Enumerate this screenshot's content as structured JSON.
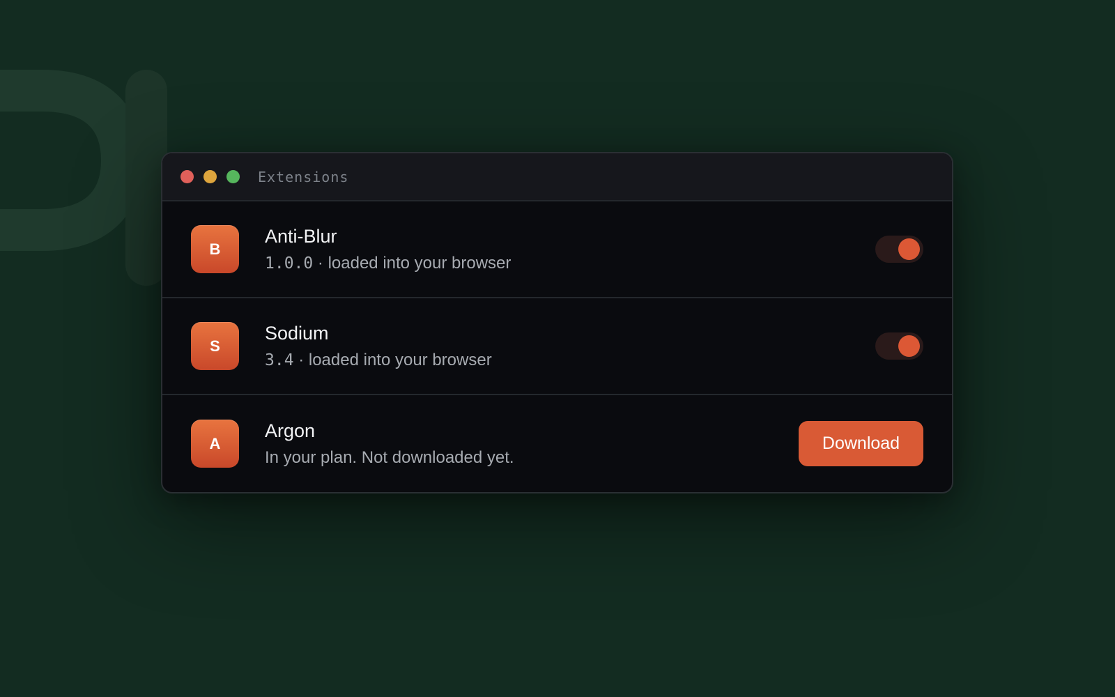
{
  "window": {
    "title": "Extensions"
  },
  "extensions": [
    {
      "icon_letter": "B",
      "name": "Anti-Blur",
      "version": "1.0.0",
      "status": " · loaded into your browser",
      "enabled": true
    },
    {
      "icon_letter": "S",
      "name": "Sodium",
      "version": "3.4",
      "status": " · loaded into your browser",
      "enabled": true
    },
    {
      "icon_letter": "A",
      "name": "Argon",
      "status": "In your plan. Not downloaded yet.",
      "action_label": "Download"
    }
  ],
  "colors": {
    "background": "#132c21",
    "accent": "#d95a35",
    "window": "#0a0b0f"
  }
}
